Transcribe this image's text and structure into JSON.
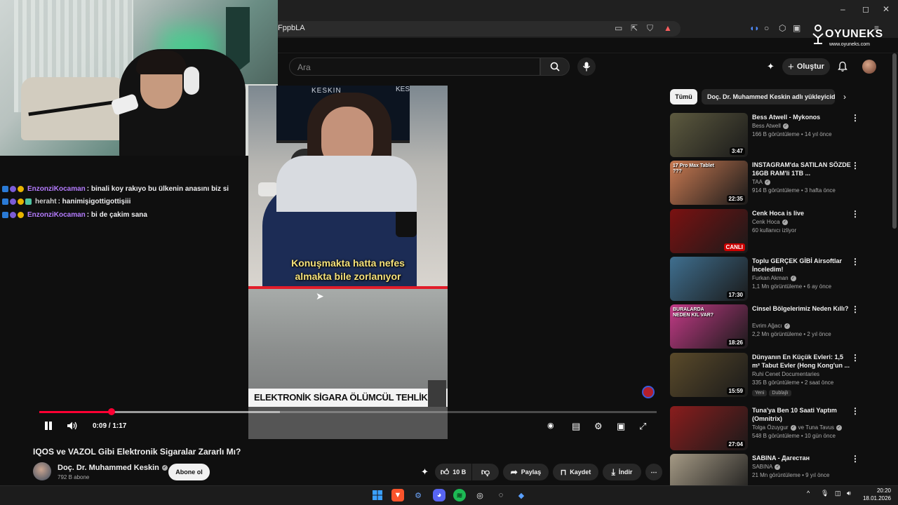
{
  "browser": {
    "url_fragment": "FppbLA",
    "window_controls": [
      "–",
      "◻",
      "✕"
    ]
  },
  "watermark": {
    "title": "OYUNEKS",
    "url": "www.oyuneks.com"
  },
  "youtube_header": {
    "search_placeholder": "Ara",
    "create_label": "Oluştur"
  },
  "chat": {
    "messages": [
      {
        "user": "EnzonziKocaman",
        "user_color": "#b57cff",
        "text": ": binali koy rakıyo bu ülkenin anasını biz si"
      },
      {
        "user": "heraht",
        "user_color": "#d0d0d0",
        "text": ": hanimişigottigottişiii"
      },
      {
        "user": "EnzonziKocaman",
        "user_color": "#b57cff",
        "text": ": bi de çakim sana"
      }
    ]
  },
  "video": {
    "tv_text": "KESKIN",
    "tv_text2": "KES",
    "caption_line1": "Konuşmakta hatta nefes",
    "caption_line2": "almakta bile zorlanıyor",
    "banner": "ELEKTRONİK SİGARA ÖLÜMCÜL TEHLİKE!",
    "time": "0:09 / 1:17",
    "progress_fraction": 0.117,
    "buffer_fraction": 0.39
  },
  "video_info": {
    "title": "IQOS ve VAZOL Gibi Elektronik Sigaralar Zararlı Mı?",
    "channel": "Doç. Dr. Muhammed Keskin",
    "subscribers": "792 B abone",
    "subscribe_label": "Abone ol",
    "likes": "10 B",
    "share_label": "Paylaş",
    "save_label": "Kaydet",
    "download_label": "İndir",
    "more_label": "⋯"
  },
  "sidebar": {
    "chips": [
      "Tümü",
      "Doç. Dr. Muhammed Keskin adlı yükleyicid"
    ],
    "recommendations": [
      {
        "title": "Bess Atwell - Mykonos",
        "channel": "Bess Atwell",
        "verified": true,
        "meta": "166 B görüntüleme • 14 yıl önce",
        "duration": "3:47",
        "thumb_color": "#5d5a3f"
      },
      {
        "title": "INSTAGRAM'da SATILAN SÖZDE 16GB RAM'li 1TB ...",
        "channel": "TAA",
        "verified": true,
        "meta": "914 B görüntüleme • 3 hafta önce",
        "duration": "22:35",
        "thumb_color": "#c97a52",
        "thumb_text": "17 Pro Max Tablet ???"
      },
      {
        "title": "Cenk Hoca is live",
        "channel": "Cenk Hoca",
        "verified": true,
        "meta": "60 kullanıcı izliyor",
        "live": "CANLI",
        "thumb_color": "#7b1111"
      },
      {
        "title": "Toplu GERÇEK GİBİ Airsoftlar İnceledim!",
        "channel": "Furkan Akman",
        "verified": true,
        "meta": "1,1 Mn görüntüleme • 6 ay önce",
        "duration": "17:30",
        "thumb_color": "#3f6f8f"
      },
      {
        "title": "Cinsel Bölgelerimiz Neden Kıllı?",
        "channel": "Evrim Ağacı",
        "verified": true,
        "meta": "2,2 Mn görüntüleme • 2 yıl önce",
        "duration": "18:26",
        "thumb_color": "#c23a86",
        "thumb_text": "BURALARDA NEDEN KIL VAR?"
      },
      {
        "title": "Dünyanın En Küçük Evleri: 1,5 m² Tabut Evler (Hong Kong'un ...",
        "channel": "Ruhi Cenet Documentaries",
        "verified": false,
        "meta": "335 B görüntüleme • 2 saat önce",
        "duration": "15:59",
        "thumb_color": "#5a4a2a",
        "tags": [
          "Yeni",
          "Dublajlı"
        ]
      },
      {
        "title": "Tuna'ya Ben 10 Saati Yaptım (Omnitrix)",
        "channel": "Tolga Özuygur",
        "channel2": "ve Tuna Tavus",
        "verified": true,
        "meta": "548 B görüntüleme • 10 gün önce",
        "duration": "27:04",
        "thumb_color": "#8a1d1d"
      },
      {
        "title": "SABINA - Дагестан",
        "channel": "SABINA",
        "verified": true,
        "meta": "21 Mn görüntüleme • 9 yıl önce",
        "duration": "",
        "thumb_color": "#a59a85"
      }
    ]
  },
  "taskbar": {
    "time": "20:20",
    "date": "18.01.2026"
  },
  "colors": {
    "accent_red": "#ff0033",
    "background": "#0f0f0f"
  }
}
